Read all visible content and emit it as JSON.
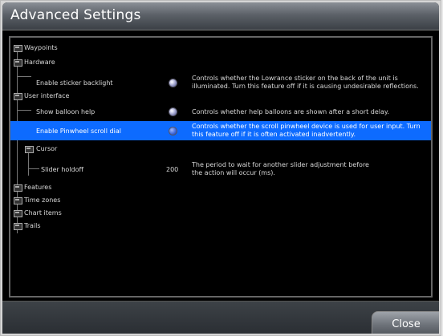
{
  "window": {
    "title": "Advanced Settings"
  },
  "tree": {
    "waypoints": "Waypoints",
    "hardware": "Hardware",
    "hardware_items": [
      {
        "label": "Enable sticker backlight",
        "description": "Controls whether the Lowrance sticker on the back of the unit is illuminated. Turn this feature off if it is causing undesirable reflections."
      }
    ],
    "user_interface": "User interface",
    "ui_items": [
      {
        "label": "Show balloon help",
        "description": "Controls whether help balloons are shown after a short delay."
      },
      {
        "label": "Enable Pinwheel scroll dial",
        "description": "Controls whether the scroll pinwheel device is used for user input. Turn this feature off if it is often activated inadvertently."
      }
    ],
    "cursor": "Cursor",
    "slider_holdoff": {
      "label": "Slider holdoff",
      "value": "200",
      "description": "The period to wait for another slider adjustment before the action will occur (ms)."
    },
    "others": [
      "Features",
      "Time zones",
      "Chart items",
      "Trails"
    ]
  },
  "buttons": {
    "close": "Close"
  },
  "colors": {
    "selection": "#0d6bff",
    "background": "#000000"
  }
}
